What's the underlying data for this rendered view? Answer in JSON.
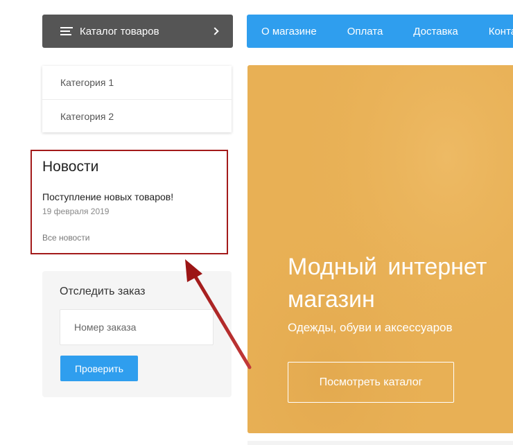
{
  "catalog": {
    "label": "Каталог товаров"
  },
  "nav": {
    "items": [
      {
        "label": "О магазине"
      },
      {
        "label": "Оплата"
      },
      {
        "label": "Доставка"
      },
      {
        "label": "Контакты"
      }
    ]
  },
  "categories": [
    {
      "label": "Категория 1"
    },
    {
      "label": "Категория 2"
    }
  ],
  "news": {
    "title": "Новости",
    "item_title": "Поступление новых товаров!",
    "item_date": "19 февраля 2019",
    "all_link": "Все новости",
    "highlight_color": "#a31a1a"
  },
  "track": {
    "title": "Отследить заказ",
    "input_placeholder": "Номер заказа",
    "input_value": "",
    "button_label": "Проверить"
  },
  "hero": {
    "title": "Модный интернет магазин",
    "subtitle": "Одежды, обуви и  аксессуаров",
    "button_label": "Посмотреть каталог",
    "background_color": "#e8b055"
  },
  "colors": {
    "accent": "#2f9eee",
    "catalog_bar": "#555555",
    "annotation_arrow": "#a31a1a"
  },
  "icons": {
    "catalog_menu": "hamburger-icon",
    "catalog_chevron": "chevron-right-icon",
    "annotation": "arrow-annotation"
  }
}
